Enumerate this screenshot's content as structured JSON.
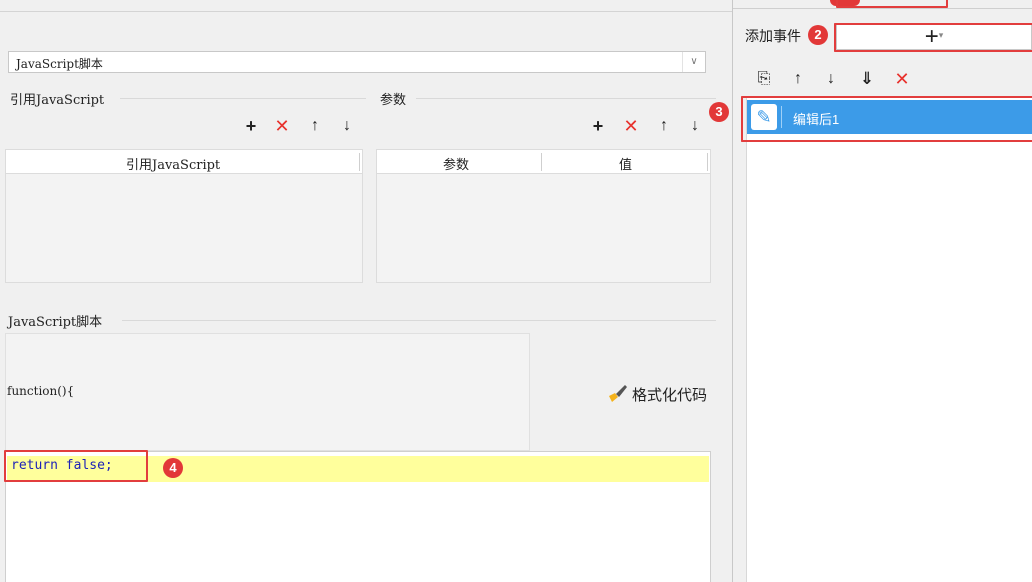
{
  "script_type_select": {
    "value": "JavaScript脚本"
  },
  "ref_section": {
    "label": "引用JavaScript",
    "column_header": "引用JavaScript",
    "rows": []
  },
  "param_section": {
    "label": "参数",
    "columns": [
      "参数",
      "值"
    ],
    "rows": []
  },
  "script_section": {
    "label": "JavaScript脚本",
    "function_header": "function(){",
    "format_button": "格式化代码",
    "code": "return false;"
  },
  "right_panel": {
    "add_event_label": "添加事件",
    "add_button": "+",
    "events": [
      {
        "name": "编辑后1",
        "selected": true
      }
    ]
  },
  "toolbar_icons": {
    "add": "+",
    "delete": "✕",
    "up": "↑",
    "down": "↓",
    "copy": "⎘",
    "move_to_bottom": "⇓"
  },
  "annotations": [
    "2",
    "3",
    "4"
  ],
  "colors": {
    "selection": "#3c9be8",
    "annotation_red": "#e23838",
    "delete_red": "#e8312c",
    "code_blue": "#1e22b8",
    "highlight_line": "#ffff9c"
  }
}
